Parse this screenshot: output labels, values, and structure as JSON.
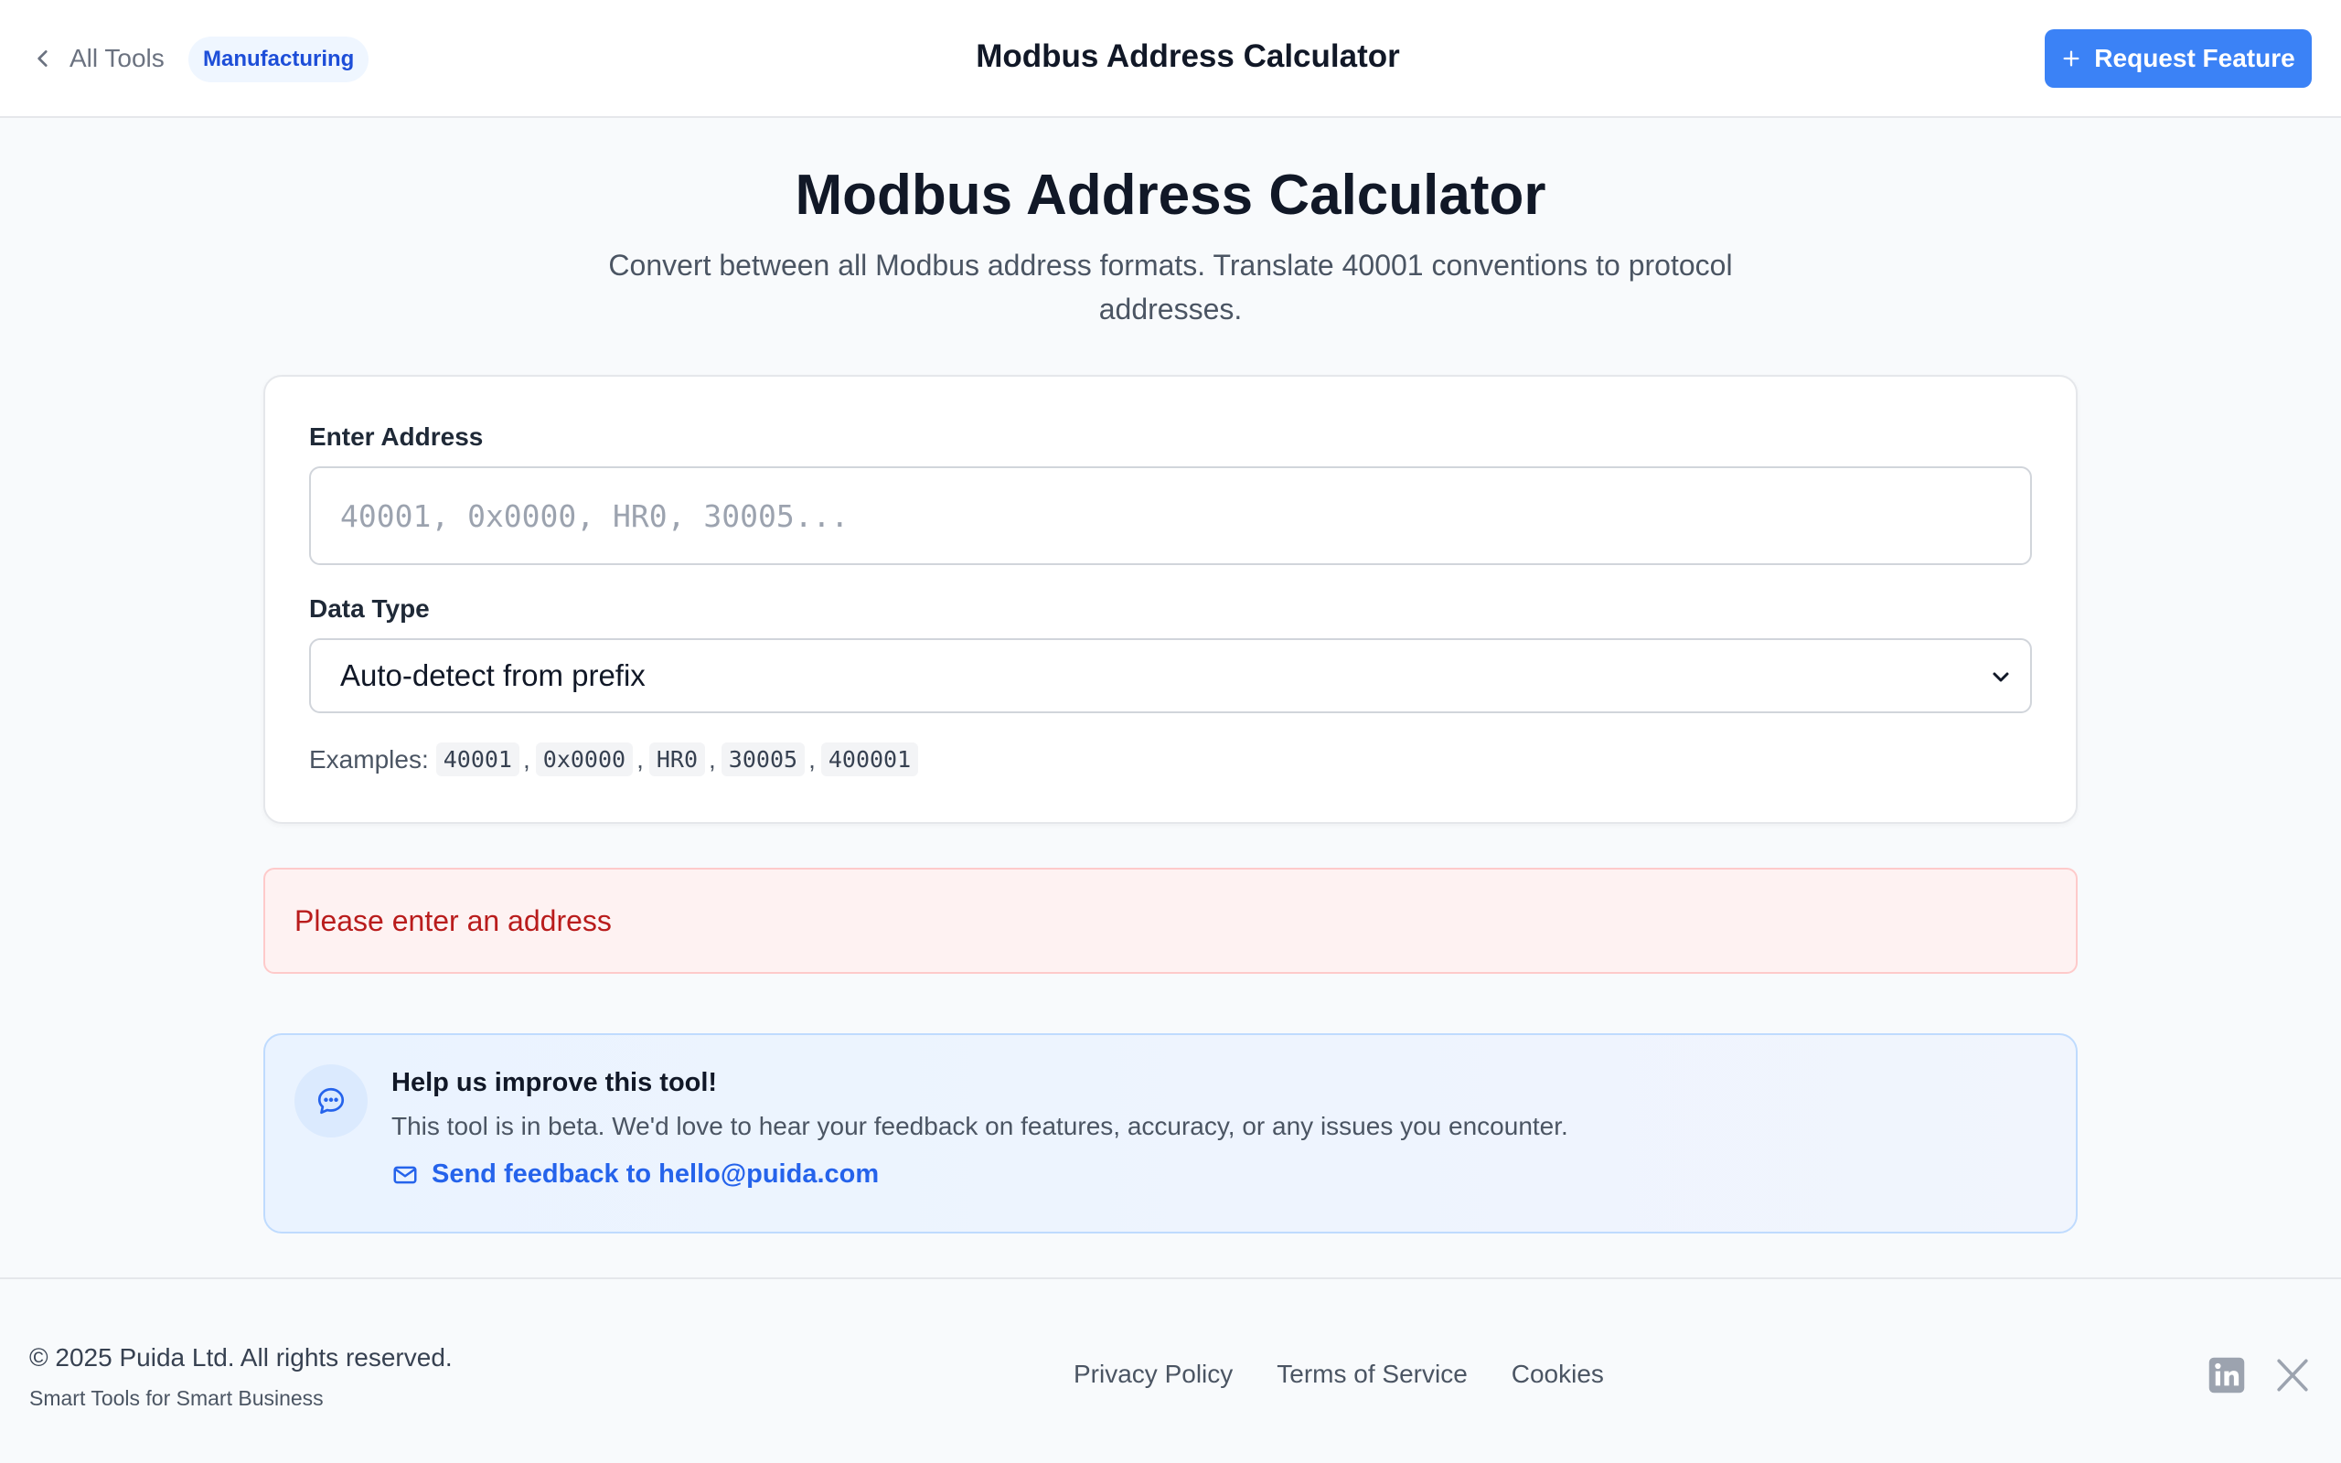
{
  "header": {
    "back_label": "All Tools",
    "category": "Manufacturing",
    "title": "Modbus Address Calculator",
    "request_label": "Request Feature"
  },
  "main": {
    "title": "Modbus Address Calculator",
    "subtitle": "Convert between all Modbus address formats. Translate 40001 conventions to protocol addresses."
  },
  "form": {
    "address_label": "Enter Address",
    "address_value": "",
    "address_placeholder": "40001, 0x0000, HR0, 30005...",
    "type_label": "Data Type",
    "type_selected": "Auto-detect from prefix",
    "examples_label": "Examples:",
    "examples": [
      "40001",
      "0x0000",
      "HR0",
      "30005",
      "400001"
    ]
  },
  "error": {
    "message": "Please enter an address"
  },
  "feedback": {
    "title": "Help us improve this tool!",
    "text": "This tool is in beta. We'd love to hear your feedback on features, accuracy, or any issues you encounter.",
    "link_label": "Send feedback to hello@puida.com"
  },
  "footer": {
    "copyright": "© 2025 Puida Ltd. All rights reserved.",
    "tagline": "Smart Tools for Smart Business",
    "links": [
      "Privacy Policy",
      "Terms of Service",
      "Cookies"
    ]
  },
  "icons": {
    "back": "chevron-left-icon",
    "plus": "plus-icon",
    "select": "chevron-down-icon",
    "feedback": "chat-bubble-icon",
    "mail": "mail-icon",
    "linkedin": "linkedin-icon",
    "x": "x-logo-icon"
  },
  "colors": {
    "accent": "#3b82f6",
    "link": "#2563eb",
    "error_text": "#b91c1c",
    "error_bg": "#fef2f2",
    "feedback_bg": "#eaf3ff"
  }
}
